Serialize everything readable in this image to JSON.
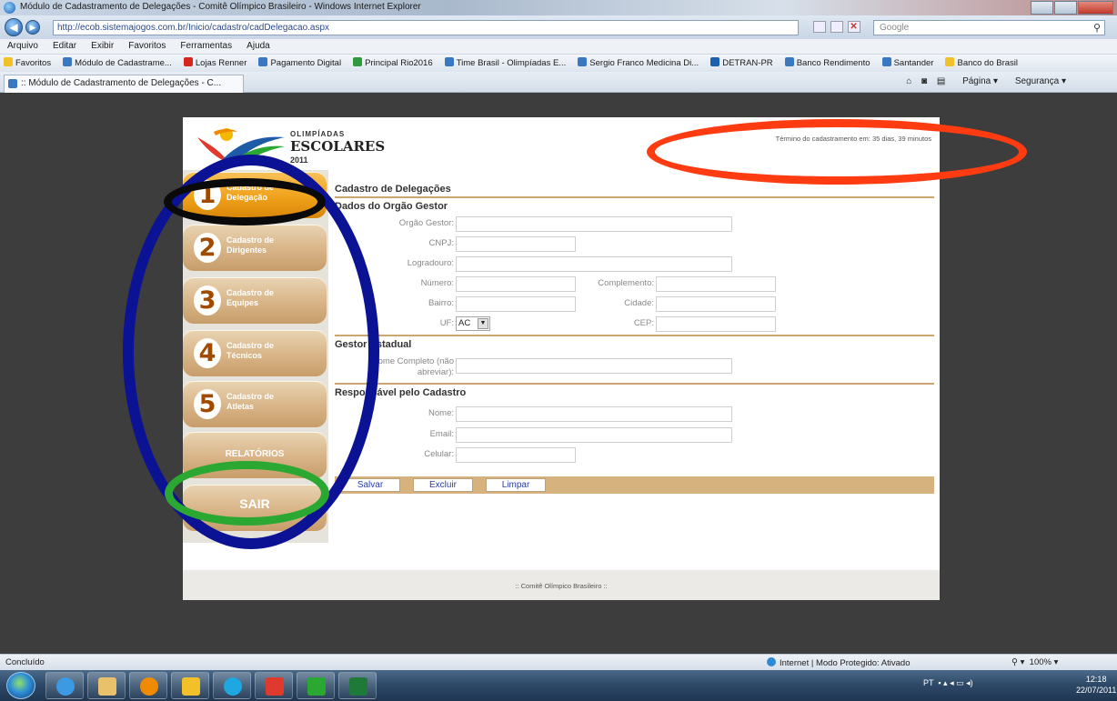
{
  "window": {
    "title": "Módulo de Cadastramento de Delegações - Comitê Olímpico Brasileiro - Windows Internet Explorer"
  },
  "addressbar": {
    "url": "http://ecob.sistemajogos.com.br/Inicio/cadastro/cadDelegacao.aspx",
    "search_placeholder": "Google"
  },
  "menubar": [
    "Arquivo",
    "Editar",
    "Exibir",
    "Favoritos",
    "Ferramentas",
    "Ajuda"
  ],
  "favorites": {
    "label": "Favoritos",
    "items": [
      "Módulo de Cadastrame...",
      "Lojas Renner",
      "Pagamento Digital",
      "Principal Rio2016",
      "Time Brasil - Olimpíadas E...",
      "Sergio Franco Medicina Di...",
      "DETRAN-PR",
      "Banco Rendimento",
      "Santander",
      "Banco do Brasil"
    ]
  },
  "tab": {
    "title": ":: Módulo de Cadastramento de Delegações - C..."
  },
  "commandbar": [
    "Página",
    "Segurança"
  ],
  "logo": {
    "line1": "OLIMPÍADAS",
    "line2": "ESCOLARES",
    "line3": "2011"
  },
  "deadline": "Término do cadastramento em: 35 dias, 39 minutos",
  "sidebar": {
    "items": [
      {
        "num": "1",
        "label": "Cadastro de Delegação"
      },
      {
        "num": "2",
        "label": "Cadastro de Dirigentes"
      },
      {
        "num": "3",
        "label": "Cadastro de Equipes"
      },
      {
        "num": "4",
        "label": "Cadastro de Técnicos"
      },
      {
        "num": "5",
        "label": "Cadastro de Atletas"
      },
      {
        "num": "",
        "label": "RELATÓRIOS"
      },
      {
        "num": "",
        "label": "SAIR"
      }
    ]
  },
  "form": {
    "page_title": "Cadastro de Delegações",
    "section_orgao": "Dados do Orgão Gestor",
    "labels": {
      "orgao_gestor": "Orgão Gestor:",
      "cnpj": "CNPJ:",
      "logradouro": "Logradouro:",
      "numero": "Número:",
      "complemento": "Complemento:",
      "bairro": "Bairro:",
      "cidade": "Cidade:",
      "uf": "UF:",
      "cep": "CEP:",
      "nome_completo": "Nome Completo (não abreviar):",
      "nome": "Nome:",
      "email": "Email:",
      "celular": "Celular:"
    },
    "uf_value": "AC",
    "section_gestor": "Gestor Estadual",
    "section_responsavel": "Responsável pelo Cadastro",
    "buttons": {
      "salvar": "Salvar",
      "excluir": "Excluir",
      "limpar": "Limpar"
    }
  },
  "footer": ":: Comitê Olímpico Brasileiro ::",
  "statusbar": {
    "left": "Concluído",
    "zone": "Internet | Modo Protegido: Ativado",
    "zoom": "100%"
  },
  "taskbar": {
    "tray": "PT",
    "time": "12:18",
    "date": "22/07/2011"
  },
  "colors": {
    "annotation_orange": "#ff3b12",
    "annotation_blue": "#0b1294",
    "annotation_black": "#0a0a0a",
    "annotation_green": "#2aa832",
    "accent_tan": "#d6b37e"
  }
}
